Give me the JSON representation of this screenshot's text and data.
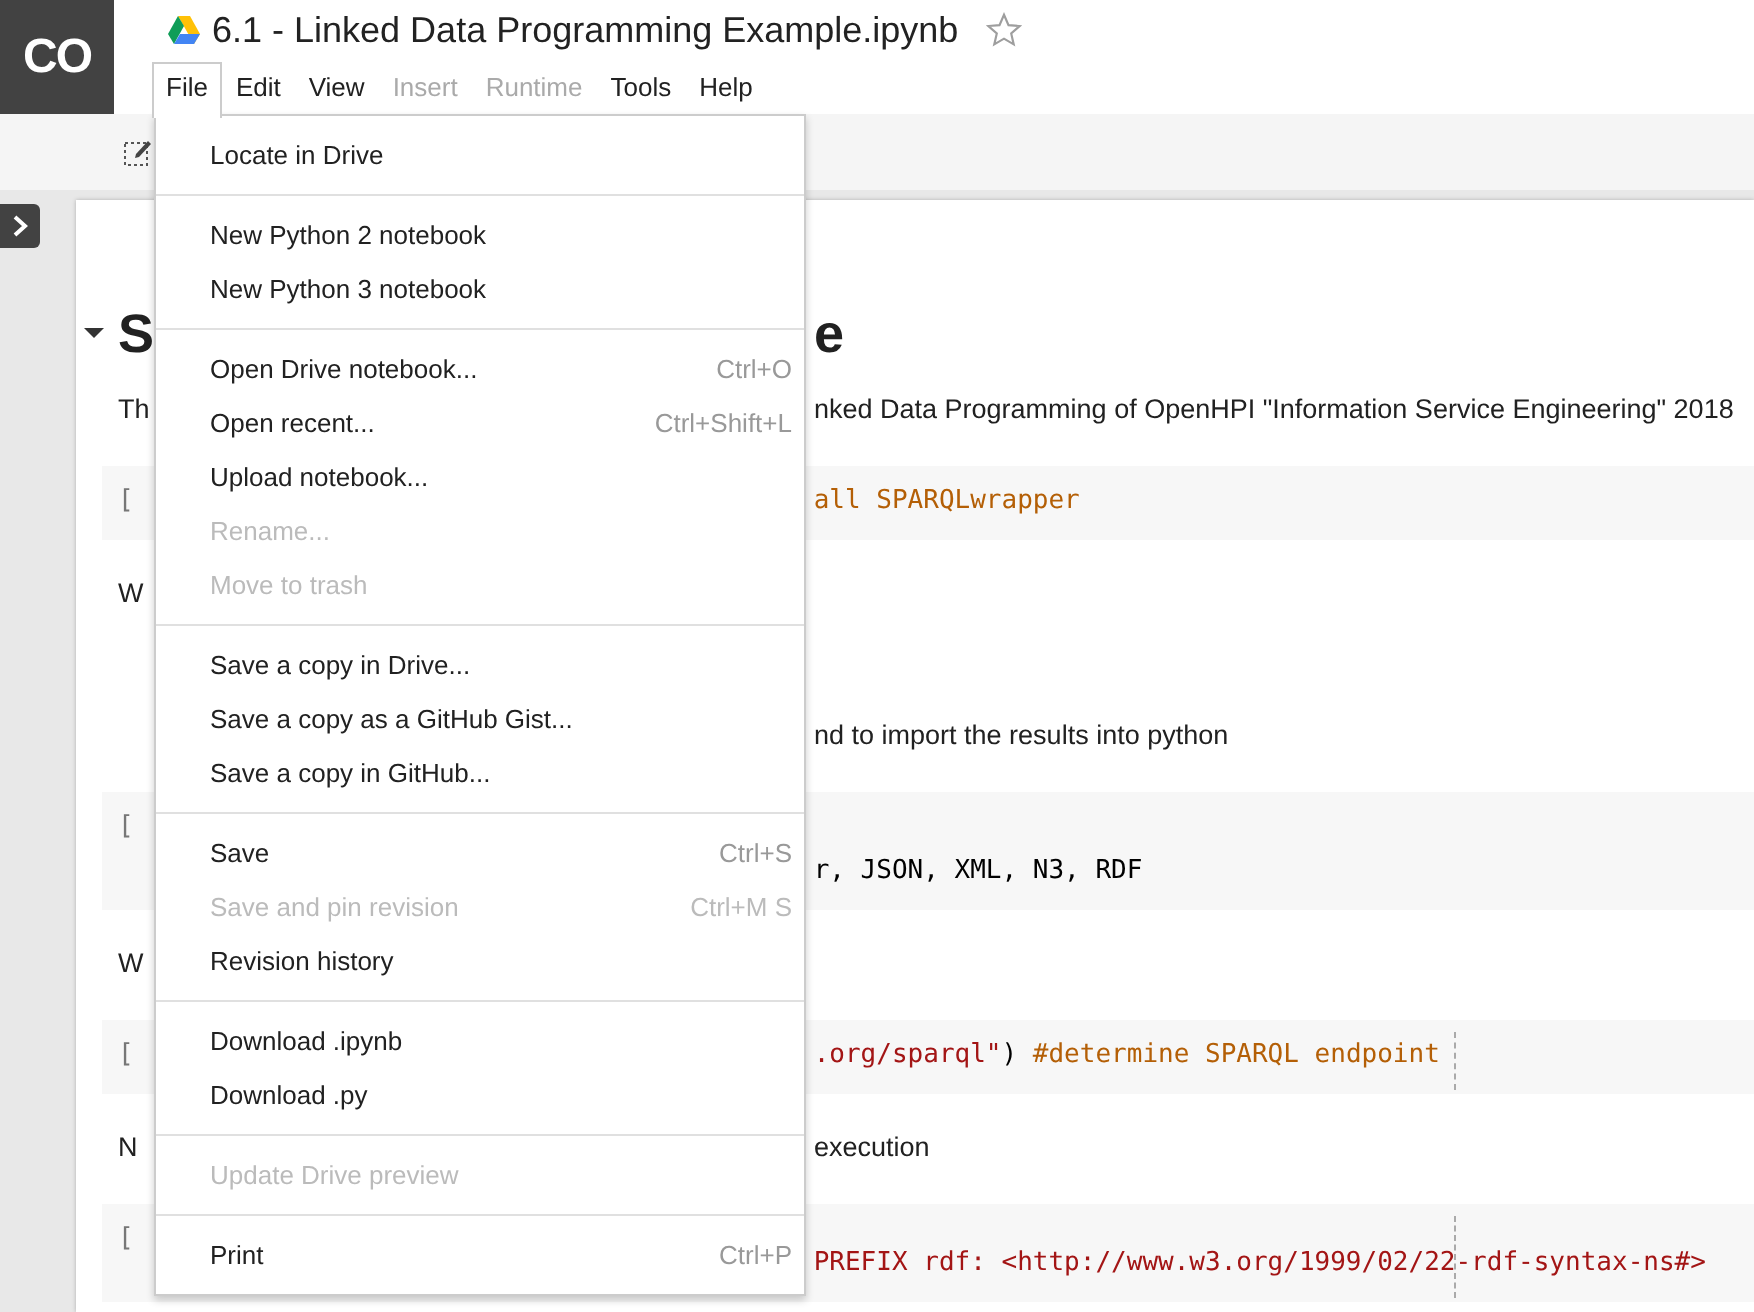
{
  "header": {
    "logo": "CO",
    "title": "6.1 - Linked Data Programming Example.ipynb",
    "starred": false
  },
  "menu_bar": [
    {
      "label": "File",
      "selected": true,
      "disabled": false
    },
    {
      "label": "Edit",
      "selected": false,
      "disabled": false
    },
    {
      "label": "View",
      "selected": false,
      "disabled": false
    },
    {
      "label": "Insert",
      "selected": false,
      "disabled": true
    },
    {
      "label": "Runtime",
      "selected": false,
      "disabled": true
    },
    {
      "label": "Tools",
      "selected": false,
      "disabled": false
    },
    {
      "label": "Help",
      "selected": false,
      "disabled": false
    }
  ],
  "file_menu": {
    "groups": [
      [
        {
          "label": "Locate in Drive",
          "disabled": false
        }
      ],
      [
        {
          "label": "New Python 2 notebook",
          "disabled": false
        },
        {
          "label": "New Python 3 notebook",
          "disabled": false
        }
      ],
      [
        {
          "label": "Open Drive notebook...",
          "shortcut": "Ctrl+O",
          "disabled": false
        },
        {
          "label": "Open recent...",
          "shortcut": "Ctrl+Shift+L",
          "disabled": false
        },
        {
          "label": "Upload notebook...",
          "disabled": false
        },
        {
          "label": "Rename...",
          "disabled": true
        },
        {
          "label": "Move to trash",
          "disabled": true
        }
      ],
      [
        {
          "label": "Save a copy in Drive...",
          "disabled": false
        },
        {
          "label": "Save a copy as a GitHub Gist...",
          "disabled": false
        },
        {
          "label": "Save a copy in GitHub...",
          "disabled": false
        }
      ],
      [
        {
          "label": "Save",
          "shortcut": "Ctrl+S",
          "disabled": false
        },
        {
          "label": "Save and pin revision",
          "shortcut": "Ctrl+M S",
          "disabled": true
        },
        {
          "label": "Revision history",
          "disabled": false
        }
      ],
      [
        {
          "label": "Download .ipynb",
          "disabled": false
        },
        {
          "label": "Download .py",
          "disabled": false
        }
      ],
      [
        {
          "label": "Update Drive preview",
          "disabled": true
        }
      ],
      [
        {
          "label": "Print",
          "shortcut": "Ctrl+P",
          "disabled": false
        }
      ]
    ]
  },
  "notebook": {
    "cells": [
      {
        "kind": "heading",
        "expanded": true,
        "left": "S",
        "right": "e"
      },
      {
        "kind": "text",
        "left": "Th",
        "right": "nked Data Programming of OpenHPI \"Information Service Engineering\" 2018"
      },
      {
        "kind": "code",
        "bracket": "[",
        "ruler": false,
        "lines": [
          {
            "tokens": [
              {
                "kind": "shell",
                "text": "all SPARQLwrapper"
              }
            ]
          }
        ]
      },
      {
        "kind": "text",
        "left": "W"
      },
      {
        "kind": "text",
        "gap": true,
        "right": "nd to import the results into python"
      },
      {
        "kind": "code",
        "bracket": "[",
        "ruler": false,
        "continued": true,
        "lines": [
          {
            "tokens": [
              {
                "kind": "plain",
                "text": "r, JSON, XML, N3, RDF"
              }
            ]
          }
        ]
      },
      {
        "kind": "text",
        "left": "W"
      },
      {
        "kind": "code",
        "bracket": "[",
        "ruler": true,
        "lines": [
          {
            "tokens": [
              {
                "kind": "string",
                "text": ".org/sparql\""
              },
              {
                "kind": "plain",
                "text": ") "
              },
              {
                "kind": "comment",
                "text": "#determine SPARQL endpoint"
              }
            ]
          }
        ]
      },
      {
        "kind": "text",
        "left": "N",
        "right": "execution"
      },
      {
        "kind": "code",
        "bracket": "[",
        "ruler": true,
        "continued": true,
        "lines": [
          {
            "tokens": [
              {
                "kind": "string",
                "text": "PREFIX rdf: <http://www.w3.org/1999/02/22-rdf-syntax-ns#>"
              }
            ]
          }
        ]
      }
    ]
  }
}
